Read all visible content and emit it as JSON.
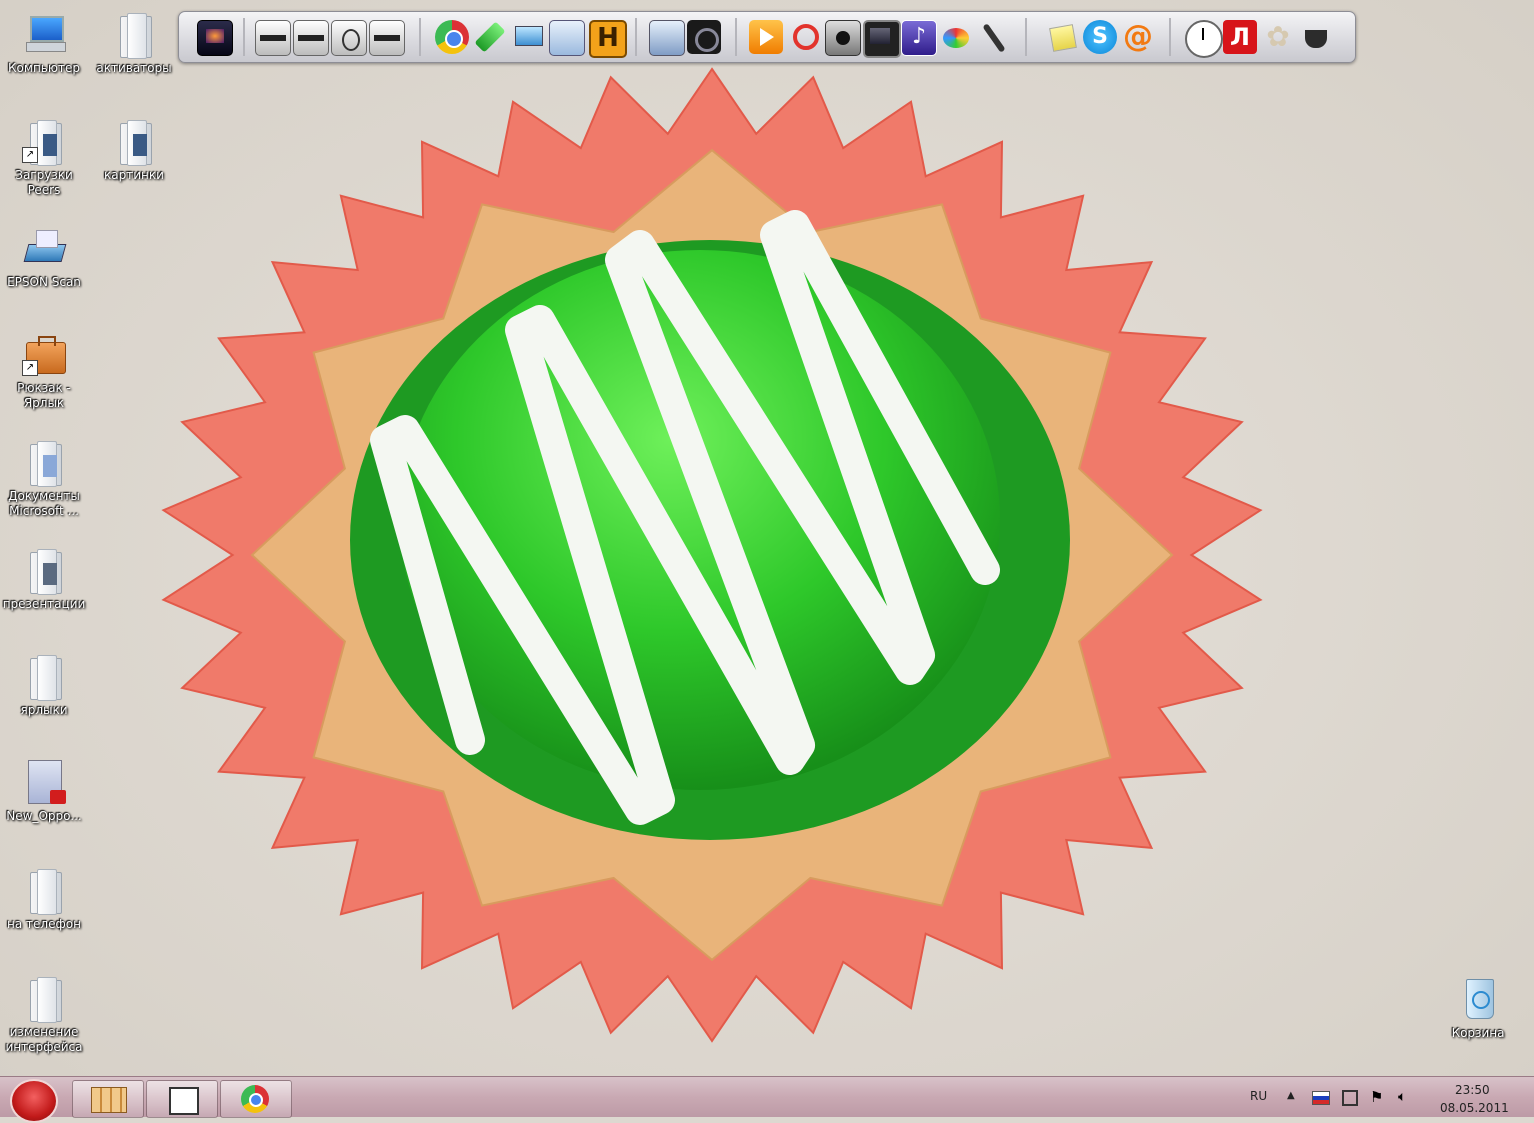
{
  "desktop": {
    "icons": [
      {
        "label": "Компьютер"
      },
      {
        "label": "активаторы"
      },
      {
        "label": "Загрузки Peers"
      },
      {
        "label": "картинки"
      },
      {
        "label": "EPSON Scan"
      },
      {
        "label": "Рюкзак - Ярлык"
      },
      {
        "label": "Документы Microsoft ..."
      },
      {
        "label": "презентации"
      },
      {
        "label": "ярлыки"
      },
      {
        "label": "New_Oppo..."
      },
      {
        "label": "на телефон"
      },
      {
        "label": "изменение интерфейса"
      }
    ],
    "recycle_bin": {
      "label": "Корзина"
    }
  },
  "dock": {
    "icons": [
      "monitor-icon",
      "media-icon-1",
      "media-icon-2",
      "media-icon-3",
      "media-icon-4",
      "chrome-icon",
      "sims-icon",
      "computer-icon",
      "calculator-icon",
      "h-icon",
      "settings-icon",
      "camera-icon",
      "play-icon",
      "search-icon",
      "photo-icon",
      "video-icon",
      "music-icon",
      "paint-icon",
      "microphone-icon",
      "notes-icon",
      "skype-icon",
      "mail-icon",
      "clock-icon",
      "avira-icon",
      "gear-icon",
      "tea-icon"
    ]
  },
  "taskbar": {
    "items": [
      "explorer-icon",
      "window-icon",
      "chrome-icon"
    ]
  },
  "tray": {
    "language": "RU",
    "time": "23:50",
    "date": "08.05.2011"
  },
  "colors": {
    "taskbar": "#c9a9b3",
    "start_orb": "#c21a1a"
  }
}
